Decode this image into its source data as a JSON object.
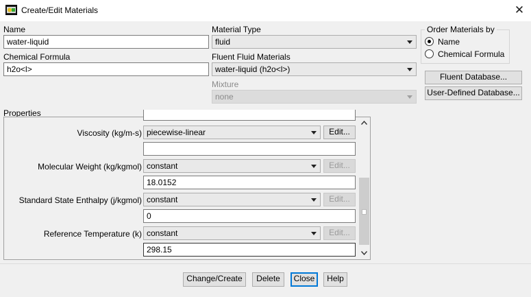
{
  "window": {
    "title": "Create/Edit Materials",
    "close_glyph": "✕"
  },
  "name": {
    "label": "Name",
    "value": "water-liquid"
  },
  "chemical_formula": {
    "label": "Chemical Formula",
    "value": "h2o<l>"
  },
  "material_type": {
    "label": "Material Type",
    "value": "fluid"
  },
  "fluent_fluid_materials": {
    "label": "Fluent Fluid Materials",
    "value": "water-liquid (h2o<l>)"
  },
  "mixture": {
    "label": "Mixture",
    "value": "none"
  },
  "order_by": {
    "label": "Order Materials by",
    "options": [
      {
        "label": "Name",
        "selected": true
      },
      {
        "label": "Chemical Formula",
        "selected": false
      }
    ]
  },
  "database_buttons": {
    "fluent": "Fluent Database...",
    "user_defined": "User-Defined Database..."
  },
  "properties": {
    "label": "Properties",
    "edit_label": "Edit...",
    "rows": [
      {
        "label": "Viscosity (kg/m-s)",
        "method": "piecewise-linear",
        "value": "",
        "edit_enabled": true
      },
      {
        "label": "Molecular Weight (kg/kgmol)",
        "method": "constant",
        "value": "18.0152",
        "edit_enabled": false
      },
      {
        "label": "Standard State Enthalpy (j/kgmol)",
        "method": "constant",
        "value": "0",
        "edit_enabled": false
      },
      {
        "label": "Reference Temperature (k)",
        "method": "constant",
        "value": "298.15",
        "edit_enabled": false
      }
    ]
  },
  "footer": {
    "change_create": "Change/Create",
    "delete": "Delete",
    "close": "Close",
    "help": "Help"
  },
  "colors": {
    "focus": "#0078d7",
    "panel": "#f0f0f0",
    "titlebar": "#ffffff"
  }
}
